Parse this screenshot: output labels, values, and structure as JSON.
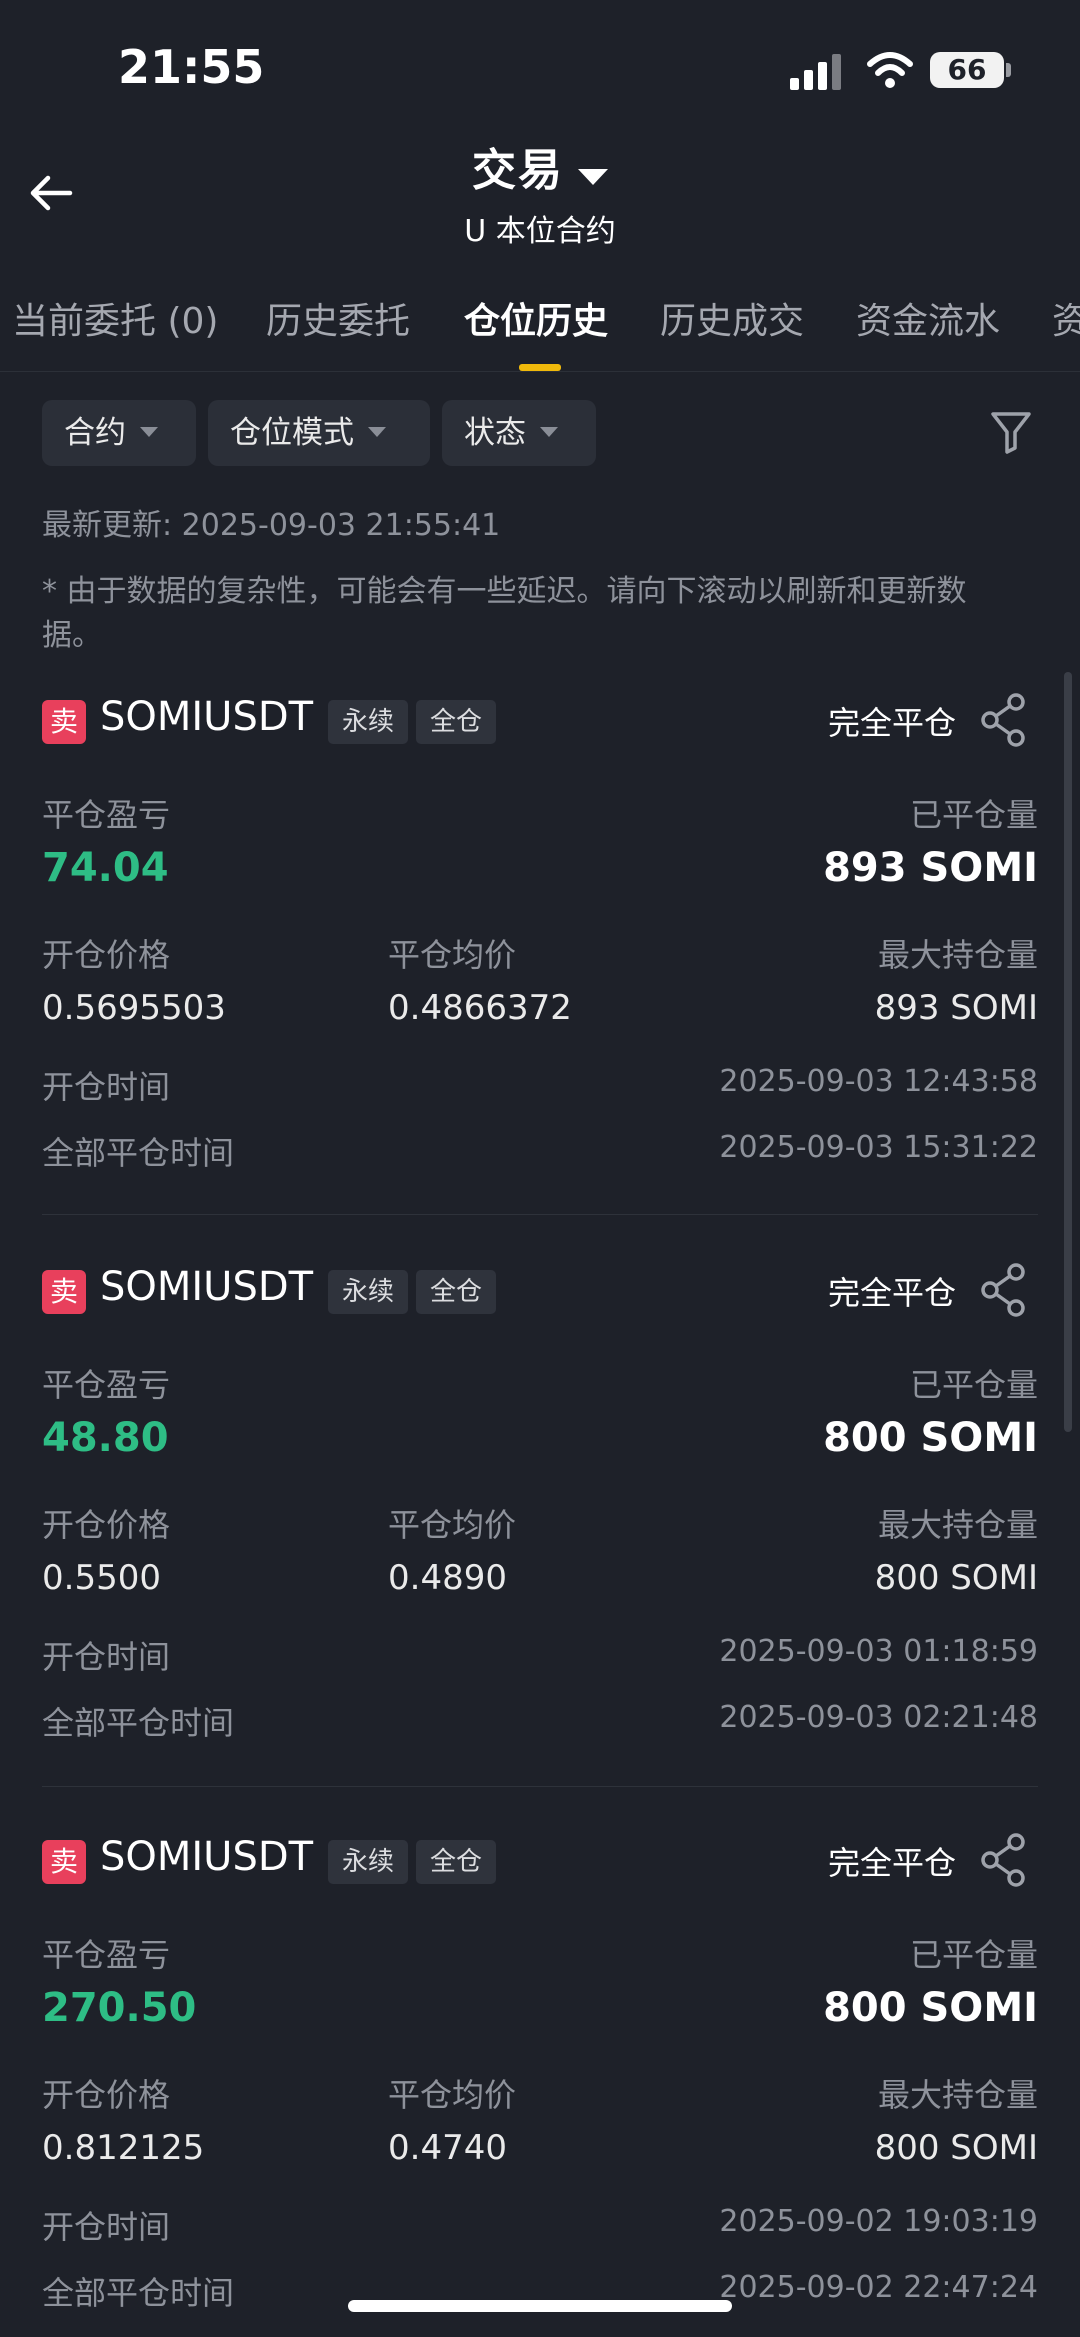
{
  "status_bar": {
    "time": "21:55",
    "battery": "66"
  },
  "header": {
    "title": "交易",
    "subtitle": "U 本位合约"
  },
  "tabs": [
    {
      "label": "当前委托 (0)"
    },
    {
      "label": "历史委托"
    },
    {
      "label": "仓位历史"
    },
    {
      "label": "历史成交"
    },
    {
      "label": "资金流水"
    },
    {
      "label": "资"
    }
  ],
  "filters": {
    "contract": "合约",
    "mode": "仓位模式",
    "status": "状态"
  },
  "updated": "最新更新: 2025-09-03 21:55:41",
  "notice": "* 由于数据的复杂性，可能会有一些延迟。请向下滚动以刷新和更新数据。",
  "labels": {
    "side": "卖",
    "perpetual": "永续",
    "cross": "全仓",
    "pnl": "平仓盈亏",
    "closed_qty": "已平仓量",
    "open_price": "开仓价格",
    "close_avg": "平仓均价",
    "max_hold": "最大持仓量",
    "open_time": "开仓时间",
    "close_time": "全部平仓时间"
  },
  "positions": [
    {
      "symbol": "SOMIUSDT",
      "status": "完全平仓",
      "pnl": "74.04",
      "closed_qty": "893 SOMI",
      "open_price": "0.5695503",
      "close_avg": "0.4866372",
      "max_hold": "893 SOMI",
      "open_time": "2025-09-03 12:43:58",
      "close_time": "2025-09-03 15:31:22"
    },
    {
      "symbol": "SOMIUSDT",
      "status": "完全平仓",
      "pnl": "48.80",
      "closed_qty": "800 SOMI",
      "open_price": "0.5500",
      "close_avg": "0.4890",
      "max_hold": "800 SOMI",
      "open_time": "2025-09-03 01:18:59",
      "close_time": "2025-09-03 02:21:48"
    },
    {
      "symbol": "SOMIUSDT",
      "status": "完全平仓",
      "pnl": "270.50",
      "closed_qty": "800 SOMI",
      "open_price": "0.812125",
      "close_avg": "0.4740",
      "max_hold": "800 SOMI",
      "open_time": "2025-09-02 19:03:19",
      "close_time": "2025-09-02 22:47:24"
    }
  ],
  "colors": {
    "accent": "#f0b90b",
    "profit": "#2ebd85",
    "sell": "#e8405c",
    "background": "#1e2129"
  }
}
